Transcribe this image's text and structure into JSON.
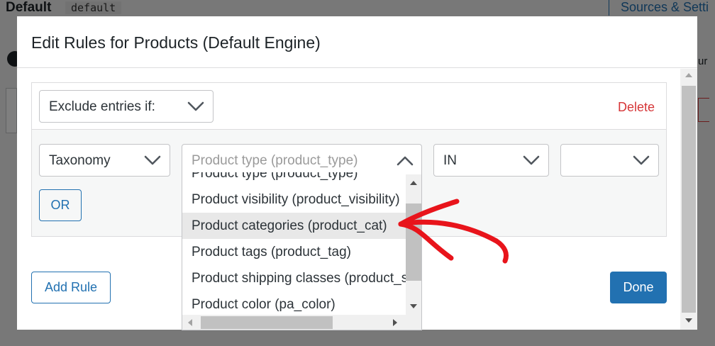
{
  "background": {
    "title": "Default",
    "code": "default",
    "sources_link": "Sources & Setti",
    "side_text": "ur"
  },
  "modal": {
    "title": "Edit Rules for Products (Default Engine)",
    "rule": {
      "condition_select": "Exclude entries if:",
      "delete_label": "Delete",
      "type_select": "Taxonomy",
      "taxonomy_placeholder": "Product type (product_type)",
      "operator_select": "IN",
      "value_select": "",
      "or_label": "OR"
    },
    "add_rule_label": "Add Rule",
    "done_label": "Done"
  },
  "dropdown": {
    "items": [
      "Product type (product_type)",
      "Product visibility (product_visibility)",
      "Product categories (product_cat)",
      "Product tags (product_tag)",
      "Product shipping classes (product_shipping_class)",
      "Product color (pa_color)"
    ],
    "highlighted": "Product categories (product_cat)"
  },
  "colors": {
    "primary": "#2271b1",
    "danger": "#d63638",
    "annotation_arrow": "#e8141b"
  },
  "icons": [
    "chevron-down-icon",
    "chevron-up-icon",
    "info-icon",
    "red-arrow-annotation"
  ]
}
